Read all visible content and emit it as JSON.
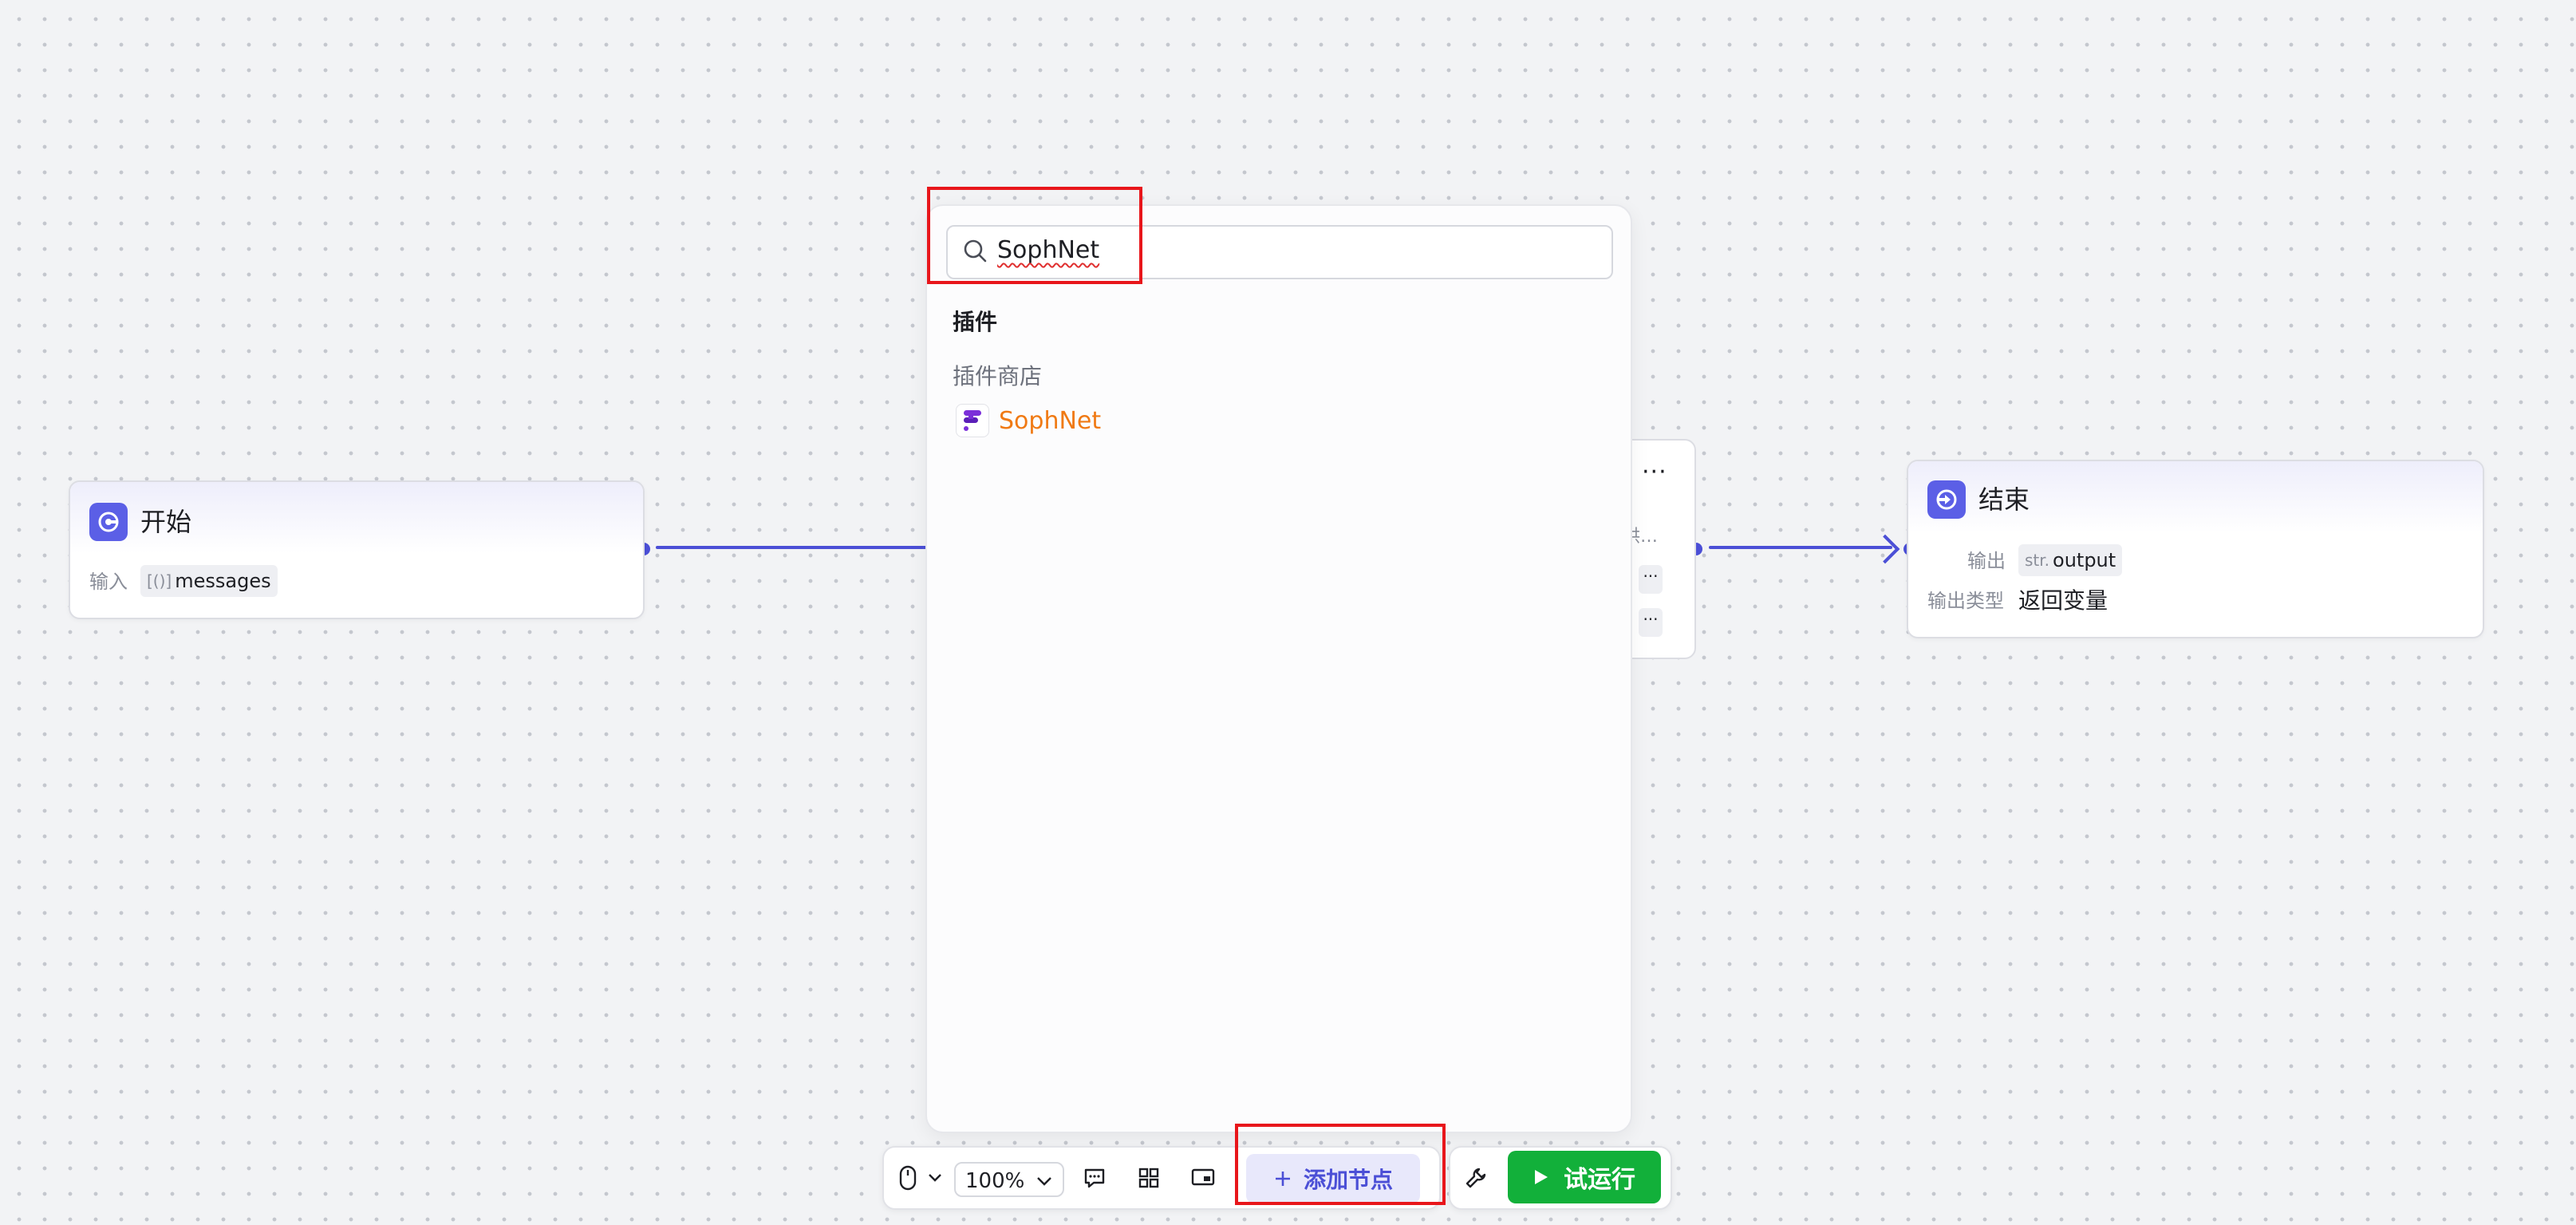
{
  "canvas": {
    "accent_color": "#4b4fd6",
    "background_color": "#f2f3f5"
  },
  "start_node": {
    "title": "开始",
    "icon": "start-icon",
    "input_label": "输入",
    "input_type_prefix": "[()]",
    "input_value": "messages"
  },
  "middle_node": {
    "menu_glyph": "···",
    "truncated_text": "提供…",
    "param_glyphs": [
      "···",
      "···"
    ]
  },
  "end_node": {
    "title": "结束",
    "icon": "end-icon",
    "output_label": "输出",
    "output_type_prefix": "str.",
    "output_value": "output",
    "output_type_label": "输出类型",
    "output_type_value": "返回变量"
  },
  "search_panel": {
    "search_value": "SophNet",
    "section_title": "插件",
    "subsection_title": "插件商店",
    "results": [
      {
        "name": "SophNet",
        "icon": "sophnet-logo-icon",
        "color": "#f07a14"
      }
    ]
  },
  "toolbar": {
    "zoom_level": "100%",
    "add_node_label": "添加节点",
    "run_label": "试运行",
    "run_color": "#12b03a"
  },
  "annotations": {
    "highlight_color": "#e8161b"
  }
}
